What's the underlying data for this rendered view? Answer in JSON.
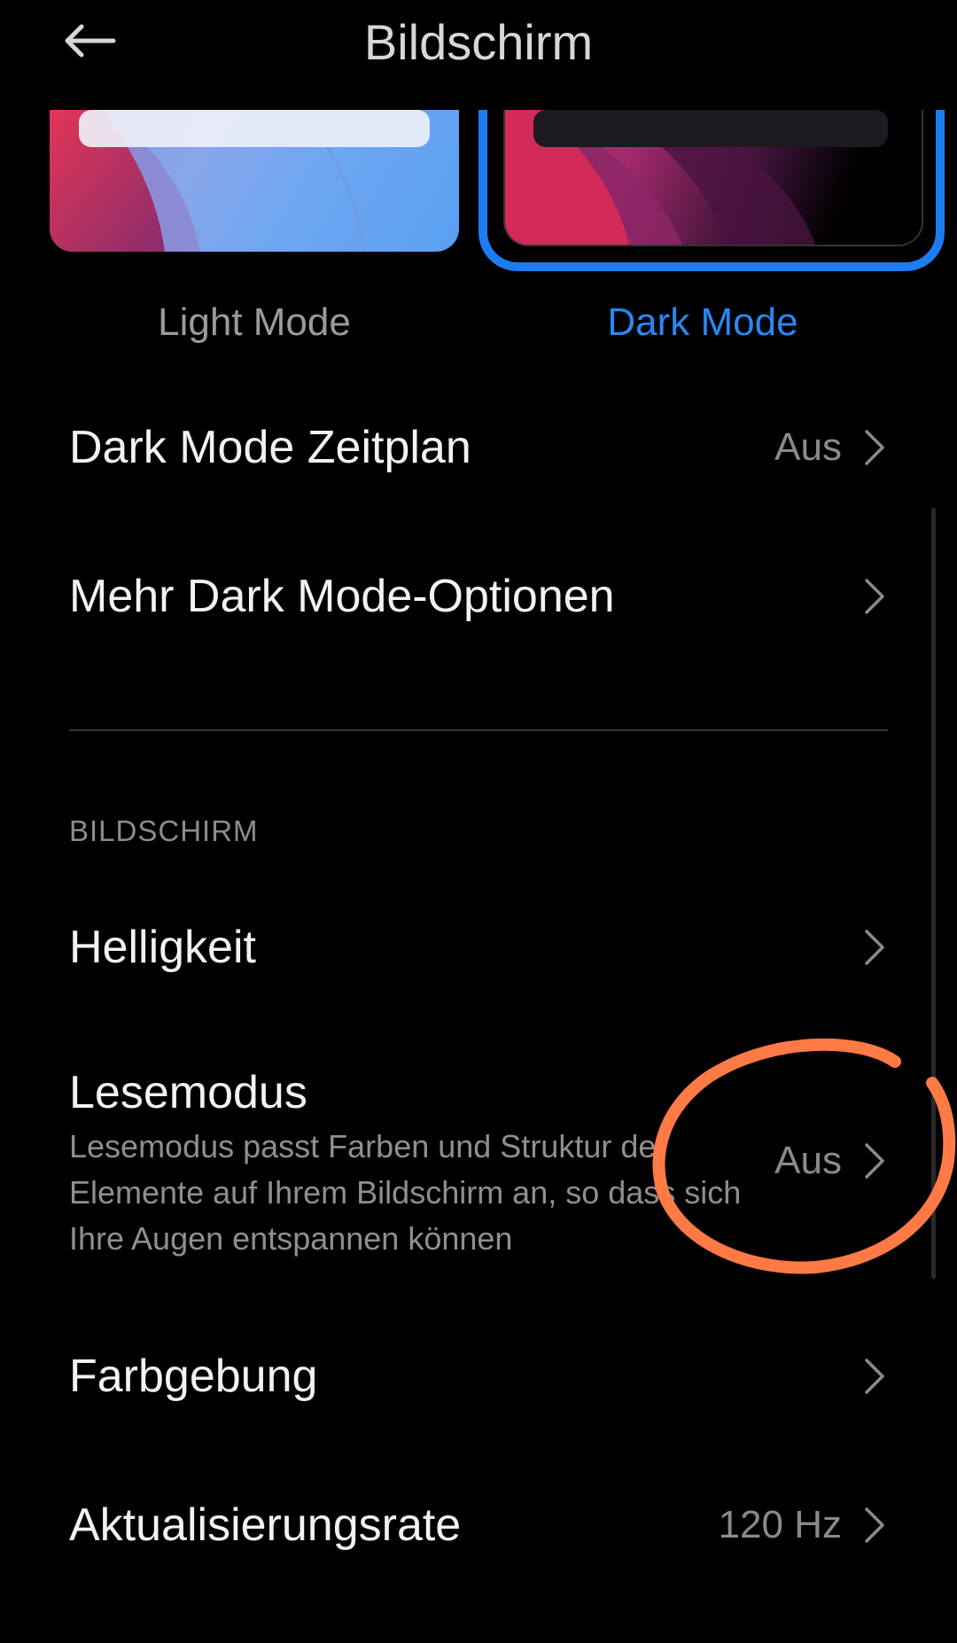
{
  "header": {
    "title": "Bildschirm",
    "back_icon": "arrow-left-icon"
  },
  "theme": {
    "light_label": "Light Mode",
    "dark_label": "Dark Mode",
    "selected": "dark",
    "accent_color": "#1d7cf2"
  },
  "rows": {
    "dark_schedule": {
      "title": "Dark Mode Zeitplan",
      "value": "Aus"
    },
    "more_dark_options": {
      "title": "Mehr Dark Mode-Optionen"
    },
    "brightness": {
      "title": "Helligkeit"
    },
    "reading_mode": {
      "title": "Lesemodus",
      "subtitle": "Lesemodus passt Farben und Struktur der Elemente auf Ihrem Bildschirm an, so dass sich Ihre Augen entspannen können",
      "value": "Aus"
    },
    "color_scheme": {
      "title": "Farbgebung"
    },
    "refresh_rate": {
      "title": "Aktualisierungsrate",
      "value": "120 Hz"
    }
  },
  "section": {
    "display_header": "BILDSCHIRM"
  },
  "annotation": {
    "color": "#ff7a45"
  }
}
